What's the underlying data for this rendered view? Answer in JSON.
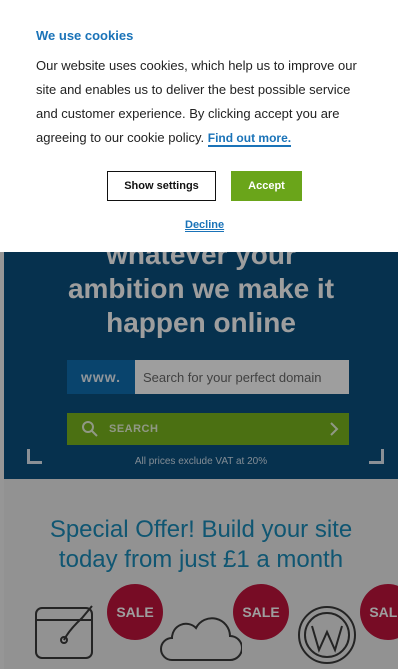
{
  "hero": {
    "title_line1": "whatever your",
    "title_line2": "ambition we make it",
    "title_line3": "happen online",
    "domain_prefix": "www.",
    "search_placeholder": "Search for your perfect domain",
    "search_button": "SEARCH",
    "vat_note": "All prices exclude VAT at 20%"
  },
  "offer": {
    "title_line1": "Special Offer! Build your site",
    "title_line2": "today from just £1 a month",
    "sale_badge": "SALE"
  },
  "cookie_banner": {
    "title": "We use cookies",
    "body": "Our website uses cookies, which help us to improve our site and enables us to deliver the best possible service and customer experience. By clicking accept you are agreeing to our cookie policy. ",
    "find_out_more": "Find out more.",
    "show_settings": "Show settings",
    "accept": "Accept",
    "decline": "Decline"
  },
  "colors": {
    "hero_bg": "#0b4f7e",
    "accent_green": "#6aa51a",
    "link_blue": "#1a73b8",
    "sale_red": "#c0143c"
  },
  "icons": [
    "search-icon",
    "chevron-right-icon",
    "laptop-icon",
    "cloud-icon",
    "wordpress-icon"
  ]
}
